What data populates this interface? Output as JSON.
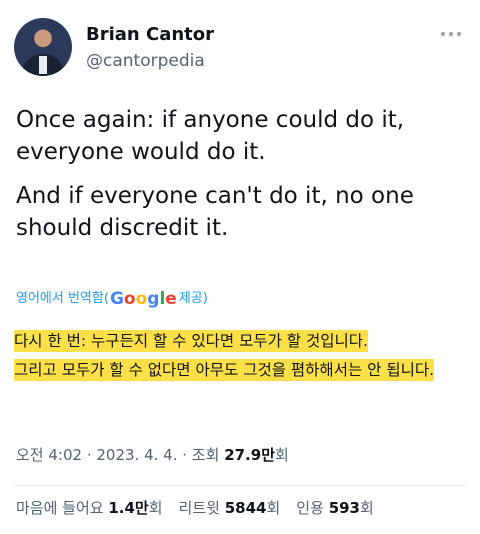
{
  "author": {
    "name": "Brian Cantor",
    "handle": "@cantorpedia"
  },
  "tweet": {
    "paragraph1": "Once again: if anyone could do it,\neveryone would do it.",
    "paragraph2": "And if everyone can't do it, no one\nshould discredit it."
  },
  "translation": {
    "prefix": "영어에서 번역함(",
    "google_logo": "Google",
    "suffix": " 제공)",
    "line1": "다시 한 번: 누구든지 할 수 있다면 모두가 할 것입니다.",
    "line2": "그리고 모두가 할 수 없다면 아무도 그것을 폄하해서는 안 됩니다.",
    "highlight_color": "#fde047"
  },
  "meta": {
    "time": "오전 4:02",
    "date": "2023. 4. 4.",
    "views_label": "조회",
    "views_value": "27.9만",
    "views_unit": "회"
  },
  "stats": {
    "likes_label": "마음에 들어요",
    "likes_value": "1.4만",
    "likes_unit": "회",
    "retweets_label": "리트윗",
    "retweets_value": "5844",
    "retweets_unit": "회",
    "quotes_label": "인용",
    "quotes_value": "593",
    "quotes_unit": "회"
  },
  "colors": {
    "link": "#1d9bf0",
    "secondary_text": "#536471",
    "primary_text": "#0f1419"
  }
}
